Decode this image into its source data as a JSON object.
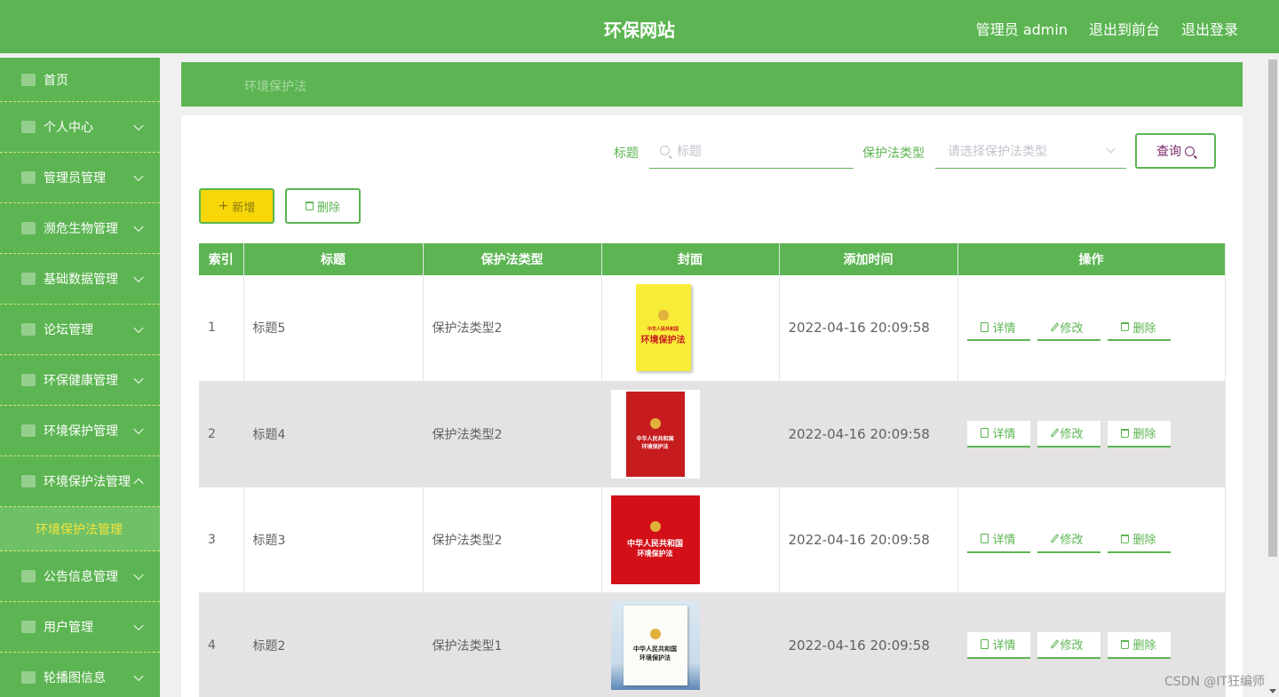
{
  "header": {
    "site_title": "环保网站",
    "admin_label": "管理员 admin",
    "back_to_front": "退出到前台",
    "logout": "退出登录"
  },
  "sidebar": {
    "items": [
      {
        "label": "首页",
        "icon": "home-icon",
        "expandable": false
      },
      {
        "label": "个人中心",
        "icon": "user-icon",
        "expandable": true
      },
      {
        "label": "管理员管理",
        "icon": "admin-icon",
        "expandable": true
      },
      {
        "label": "濒危生物管理",
        "icon": "leaf-icon",
        "expandable": true
      },
      {
        "label": "基础数据管理",
        "icon": "grid-icon",
        "expandable": true
      },
      {
        "label": "论坛管理",
        "icon": "forum-icon",
        "expandable": true
      },
      {
        "label": "环保健康管理",
        "icon": "filter-icon",
        "expandable": true
      },
      {
        "label": "环境保护管理",
        "icon": "expand-icon",
        "expandable": true
      },
      {
        "label": "环境保护法管理",
        "icon": "book-icon",
        "expandable": true,
        "expanded": true
      },
      {
        "label": "公告信息管理",
        "icon": "notice-icon",
        "expandable": true
      },
      {
        "label": "用户管理",
        "icon": "users-icon",
        "expandable": true
      },
      {
        "label": "轮播图信息",
        "icon": "gear-icon",
        "expandable": true
      }
    ],
    "active_sub_item": "环境保护法管理"
  },
  "breadcrumb": {
    "current": "环境保护法"
  },
  "search": {
    "title_label": "标题",
    "title_placeholder": "标题",
    "type_label": "保护法类型",
    "type_placeholder": "请选择保护法类型",
    "query_button": "查询"
  },
  "actions": {
    "add": "新增",
    "delete": "删除"
  },
  "table": {
    "columns": [
      "索引",
      "标题",
      "保护法类型",
      "封面",
      "添加时间",
      "操作"
    ],
    "rows": [
      {
        "index": "1",
        "title": "标题5",
        "type": "保护法类型2",
        "cover_title1": "中华人民共和国",
        "cover_title2": "环境保护法",
        "time": "2022-04-16 20:09:58"
      },
      {
        "index": "2",
        "title": "标题4",
        "type": "保护法类型2",
        "cover_title1": "中华人民共和国",
        "cover_title2": "环境保护法",
        "time": "2022-04-16 20:09:58"
      },
      {
        "index": "3",
        "title": "标题3",
        "type": "保护法类型2",
        "cover_title1": "中华人民共和国",
        "cover_title2": "环境保护法",
        "time": "2022-04-16 20:09:58"
      },
      {
        "index": "4",
        "title": "标题2",
        "type": "保护法类型1",
        "cover_title1": "中华人民共和国",
        "cover_title2": "环境保护法",
        "time": "2022-04-16 20:09:58"
      }
    ],
    "row_actions": {
      "detail": "详情",
      "edit": "修改",
      "delete": "删除"
    }
  },
  "watermark": "CSDN @IT狂编师",
  "colors": {
    "primary_green": "#5cb552",
    "add_yellow": "#f7d708",
    "active_sub_text": "#f5e43a"
  }
}
